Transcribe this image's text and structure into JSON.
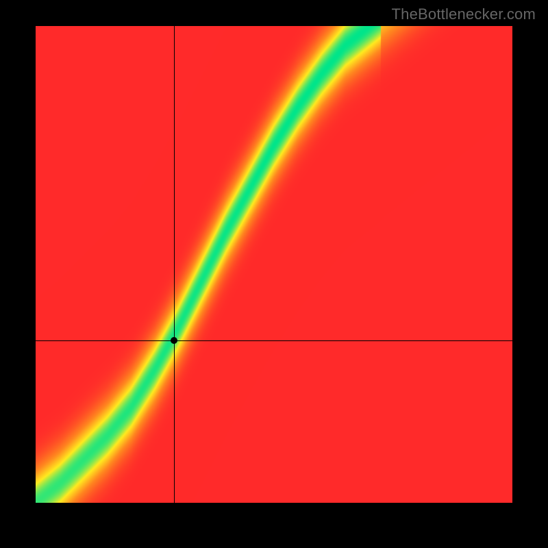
{
  "watermark": "TheBottlenecker.com",
  "chart_data": {
    "type": "heatmap",
    "title": "",
    "xlabel": "",
    "ylabel": "",
    "xlim": [
      0,
      1
    ],
    "ylim": [
      0,
      1
    ],
    "grid": false,
    "legend": false,
    "marker": {
      "x": 0.29,
      "y": 0.66
    },
    "crosshair": {
      "x": 0.29,
      "y": 0.66
    },
    "ridge": {
      "description": "Green optimal band: y ≈ f(x), with color falling off by |y - f(x)| distance",
      "points": [
        {
          "x": 0.0,
          "y": 1.0
        },
        {
          "x": 0.05,
          "y": 0.96
        },
        {
          "x": 0.1,
          "y": 0.91
        },
        {
          "x": 0.15,
          "y": 0.86
        },
        {
          "x": 0.2,
          "y": 0.8
        },
        {
          "x": 0.25,
          "y": 0.72
        },
        {
          "x": 0.3,
          "y": 0.63
        },
        {
          "x": 0.35,
          "y": 0.53
        },
        {
          "x": 0.4,
          "y": 0.43
        },
        {
          "x": 0.45,
          "y": 0.34
        },
        {
          "x": 0.5,
          "y": 0.25
        },
        {
          "x": 0.55,
          "y": 0.17
        },
        {
          "x": 0.6,
          "y": 0.1
        },
        {
          "x": 0.65,
          "y": 0.04
        },
        {
          "x": 0.7,
          "y": 0.0
        }
      ],
      "band_width": 0.05
    },
    "colorscale": [
      {
        "stop": 0.0,
        "color": "#ff2a2a",
        "meaning": "worst"
      },
      {
        "stop": 0.4,
        "color": "#ff8a1f",
        "meaning": "poor"
      },
      {
        "stop": 0.7,
        "color": "#ffeb1f",
        "meaning": "ok"
      },
      {
        "stop": 1.0,
        "color": "#00e58b",
        "meaning": "optimal"
      }
    ]
  }
}
